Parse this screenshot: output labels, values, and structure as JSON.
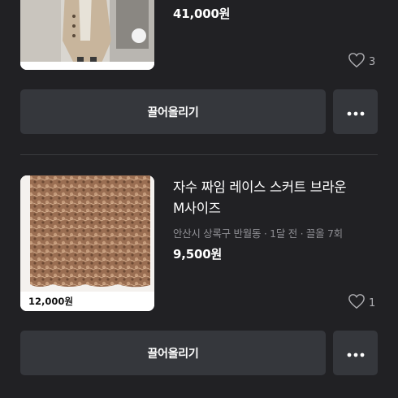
{
  "listings": [
    {
      "price": "41,000원",
      "likes": "3",
      "bump_label": "끌어올리기",
      "more_icon": "more-horizontal-icon"
    },
    {
      "title_line1": "자수 짜임 레이스 스커트 브라운",
      "title_line2": "M사이즈",
      "meta": "안산시 상록구 반월동 · 1달 전 · 끌올 7회",
      "price": "9,500원",
      "thumb_price": "12,000원",
      "likes": "1",
      "bump_label": "끌어올리기",
      "more_icon": "more-horizontal-icon"
    }
  ],
  "colors": {
    "background": "#212124",
    "button": "#35373c",
    "meta_text": "#8e8e93"
  }
}
